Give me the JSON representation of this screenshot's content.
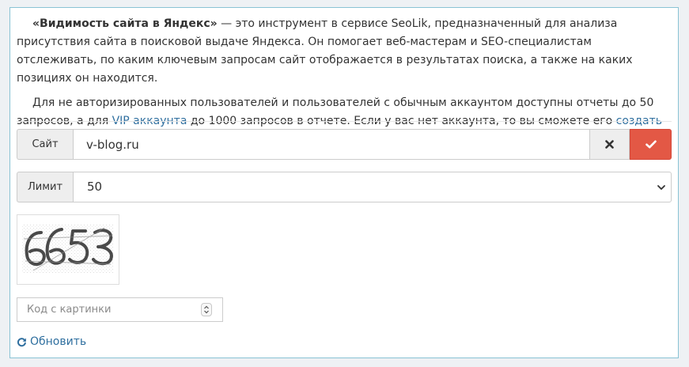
{
  "description": {
    "p1_bold": "«Видимость сайта в Яндекс»",
    "p1_rest": " — это инструмент в сервисе SeoLik, предназначенный для анализа присутствия сайта в поисковой выдаче Яндекса. Он помогает веб-мастерам и SEO-специалистам отслеживать, по каким ключевым запросам сайт отображается в результатах поиска, а также на каких позициях он находится.",
    "p2_before": "Для не авторизированных пользователей и пользователей с обычным аккаунтом доступны отчеты до 50 запросов, а для ",
    "p2_vip_link": "VIP аккаунта",
    "p2_middle": " до 1000 запросов в отчете. Если у вас нет аккаунта, то вы сможете его ",
    "p2_create_link": "создать в пару кликов",
    "p2_end": "."
  },
  "site_row": {
    "label": "Сайт",
    "value": "v-blog.ru",
    "clear_icon": "times-icon",
    "submit_icon": "check-icon"
  },
  "limit_row": {
    "label": "Лимит",
    "selected": "50",
    "arrow_icon": "chevron-down-icon"
  },
  "captcha": {
    "image_text": "6653"
  },
  "code_input": {
    "placeholder": "Код с картинки"
  },
  "refresh": {
    "label": "Обновить",
    "icon": "refresh-icon"
  },
  "colors": {
    "link": "#2f6f9f",
    "submit": "#e35845",
    "panel_border": "#89c3d4"
  }
}
